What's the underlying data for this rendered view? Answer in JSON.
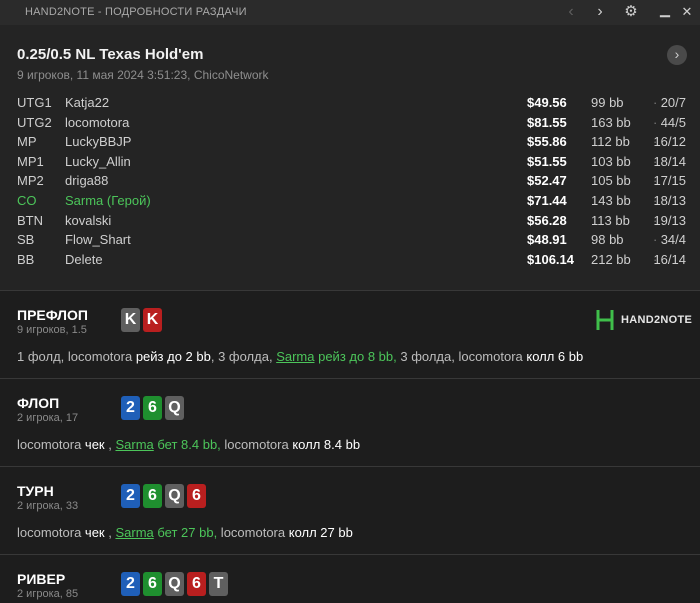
{
  "window": {
    "title": "HAND2NOTE - ПОДРОБНОСТИ РАЗДАЧИ"
  },
  "icons": {
    "prev": "chevron-left-icon",
    "next": "chevron-right-icon",
    "settings": "gear-icon",
    "minimize": "minimize-icon",
    "close": "close-icon",
    "next_hand": "circle-chevron-right-icon"
  },
  "colors": {
    "hero": "#4cc55a",
    "card_red": "#b91f1f",
    "card_blue": "#1f5fb8",
    "card_green": "#1f8f2f",
    "card_gray": "#5f5f5f",
    "background": "#1d1d1d"
  },
  "header": {
    "game": "0.25/0.5 NL Texas Hold'em",
    "sub": "9 игроков, 11 мая 2024 3:51:23, ChicoNetwork"
  },
  "players": [
    {
      "pos": "UTG1",
      "name": "Katja22",
      "stack": "$49.56",
      "bb": "99 bb",
      "dot": "·",
      "stat": "20/7"
    },
    {
      "pos": "UTG2",
      "name": "locomotora",
      "stack": "$81.55",
      "bb": "163 bb",
      "dot": "·",
      "stat": "44/5"
    },
    {
      "pos": "MP",
      "name": "LuckyBBJP",
      "stack": "$55.86",
      "bb": "112 bb",
      "dot": "·",
      "stat": "16/12"
    },
    {
      "pos": "MP1",
      "name": "Lucky_Allin",
      "stack": "$51.55",
      "bb": "103 bb",
      "dot": "·",
      "stat": "18/14"
    },
    {
      "pos": "MP2",
      "name": "driga88",
      "stack": "$52.47",
      "bb": "105 bb",
      "dot": "·",
      "stat": "17/15"
    },
    {
      "pos": "CO",
      "name": "Sarma (Герой)",
      "stack": "$71.44",
      "bb": "143 bb",
      "dot": "·",
      "stat": "18/13",
      "hero": true
    },
    {
      "pos": "BTN",
      "name": "kovalski",
      "stack": "$56.28",
      "bb": "113 bb",
      "dot": "·",
      "stat": "19/13"
    },
    {
      "pos": "SB",
      "name": "Flow_Shart",
      "stack": "$48.91",
      "bb": "98 bb",
      "dot": "·",
      "stat": "34/4"
    },
    {
      "pos": "BB",
      "name": "Delete",
      "stack": "$106.14",
      "bb": "212 bb",
      "dot": "·",
      "stat": "16/14"
    }
  ],
  "logo": {
    "text": "HAND2NOTE"
  },
  "streets": [
    {
      "title": "ПРЕФЛОП",
      "sub": "9 игроков, 1.5",
      "cards": [
        {
          "rank": "K",
          "color": "gray"
        },
        {
          "rank": "K",
          "color": "red"
        }
      ],
      "actions": [
        {
          "t": "1 фолд, ",
          "s": "n"
        },
        {
          "t": "locomotora ",
          "s": "n"
        },
        {
          "t": "рейз до 2 bb",
          "s": "b"
        },
        {
          "t": ", 3 фолда, ",
          "s": "n"
        },
        {
          "t": "Sarma",
          "s": "gu"
        },
        {
          "t": " рейз до 8 bb,",
          "s": "g"
        },
        {
          "t": " 3 фолда, locomotora ",
          "s": "n"
        },
        {
          "t": "колл 6 bb",
          "s": "b"
        }
      ]
    },
    {
      "title": "ФЛОП",
      "sub": "2 игрока, 17",
      "cards": [
        {
          "rank": "2",
          "color": "blue"
        },
        {
          "rank": "6",
          "color": "green"
        },
        {
          "rank": "Q",
          "color": "gray"
        }
      ],
      "actions": [
        {
          "t": "locomotora ",
          "s": "n"
        },
        {
          "t": "чек",
          "s": "b"
        },
        {
          "t": " , ",
          "s": "n"
        },
        {
          "t": "Sarma",
          "s": "gu"
        },
        {
          "t": " бет 8.4 bb,",
          "s": "g"
        },
        {
          "t": " locomotora ",
          "s": "n"
        },
        {
          "t": "колл 8.4 bb",
          "s": "b"
        }
      ]
    },
    {
      "title": "ТУРН",
      "sub": "2 игрока, 33",
      "cards": [
        {
          "rank": "2",
          "color": "blue"
        },
        {
          "rank": "6",
          "color": "green"
        },
        {
          "rank": "Q",
          "color": "gray"
        },
        {
          "rank": "6",
          "color": "red"
        }
      ],
      "actions": [
        {
          "t": "locomotora ",
          "s": "n"
        },
        {
          "t": "чек",
          "s": "b"
        },
        {
          "t": " , ",
          "s": "n"
        },
        {
          "t": "Sarma",
          "s": "gu"
        },
        {
          "t": " бет 27 bb,",
          "s": "g"
        },
        {
          "t": " locomotora ",
          "s": "n"
        },
        {
          "t": "колл 27 bb",
          "s": "b"
        }
      ]
    },
    {
      "title": "РИВЕР",
      "sub": "2 игрока, 85",
      "cards": [
        {
          "rank": "2",
          "color": "blue"
        },
        {
          "rank": "6",
          "color": "green"
        },
        {
          "rank": "Q",
          "color": "gray"
        },
        {
          "rank": "6",
          "color": "red"
        },
        {
          "rank": "T",
          "color": "gray"
        }
      ],
      "actions": []
    }
  ]
}
